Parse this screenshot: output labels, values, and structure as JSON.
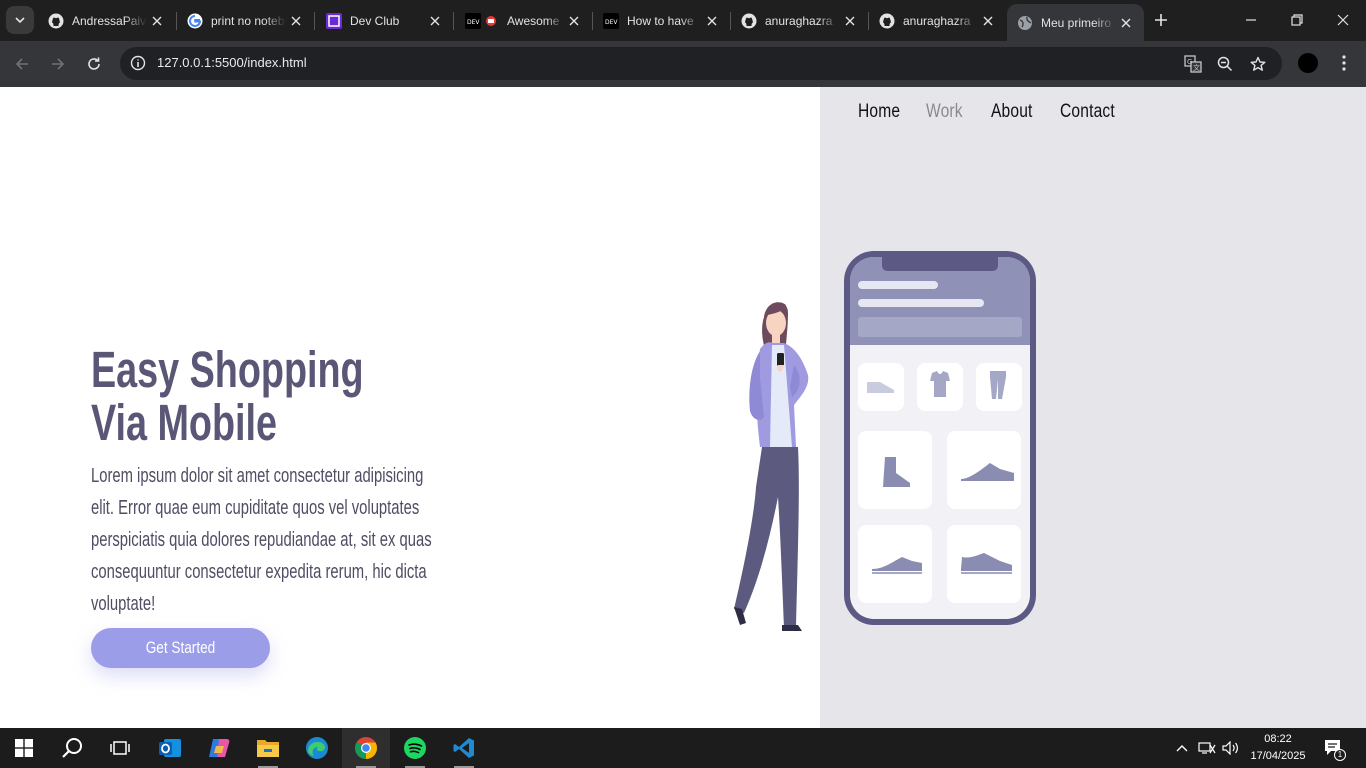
{
  "browser": {
    "tabs": [
      {
        "title": "AndressaPaiva",
        "icon": "github-icon"
      },
      {
        "title": "print no notebook",
        "icon": "google-icon"
      },
      {
        "title": "Dev Club",
        "icon": "devclub-icon"
      },
      {
        "title": "Awesome",
        "icon": "dev-icon"
      },
      {
        "title": "How to have",
        "icon": "dev-icon"
      },
      {
        "title": "anuraghazra",
        "icon": "github-icon"
      },
      {
        "title": "anuraghazra",
        "icon": "github-icon"
      },
      {
        "title": "Meu primeiro",
        "icon": "globe-icon"
      }
    ],
    "active_tab": 7,
    "url": "127.0.0.1:5500/index.html",
    "colors": {
      "chrome_dark": "#1f1f1f",
      "toolbar": "#35363a"
    }
  },
  "page": {
    "nav": {
      "home": "Home",
      "work": "Work",
      "about": "About",
      "contact": "Contact"
    },
    "hero": {
      "title_line1": "Easy Shopping",
      "title_line2": "Via Mobile",
      "text": "Lorem ipsum dolor sit amet consectetur adipisicing elit. Error quae eum cupiditate quos vel voluptates perspiciatis quia dolores repudiandae at, sit ex quas consequuntur consectetur expedita rerum, hic dicta voluptate!",
      "cta": "Get Started"
    },
    "colors": {
      "accent": "#9b9de8",
      "title": "#5a5676",
      "panel": "#e6e5ea",
      "phone": "#5c5a85"
    }
  },
  "taskbar": {
    "apps": [
      "windows-start-icon",
      "search-icon",
      "task-view-icon",
      "outlook-icon",
      "copilot-icon",
      "file-explorer-icon",
      "edge-icon",
      "chrome-icon",
      "spotify-icon",
      "vscode-icon"
    ],
    "active_app": "chrome-icon",
    "time": "08:22",
    "date": "17/04/2025",
    "notifications": "1"
  }
}
